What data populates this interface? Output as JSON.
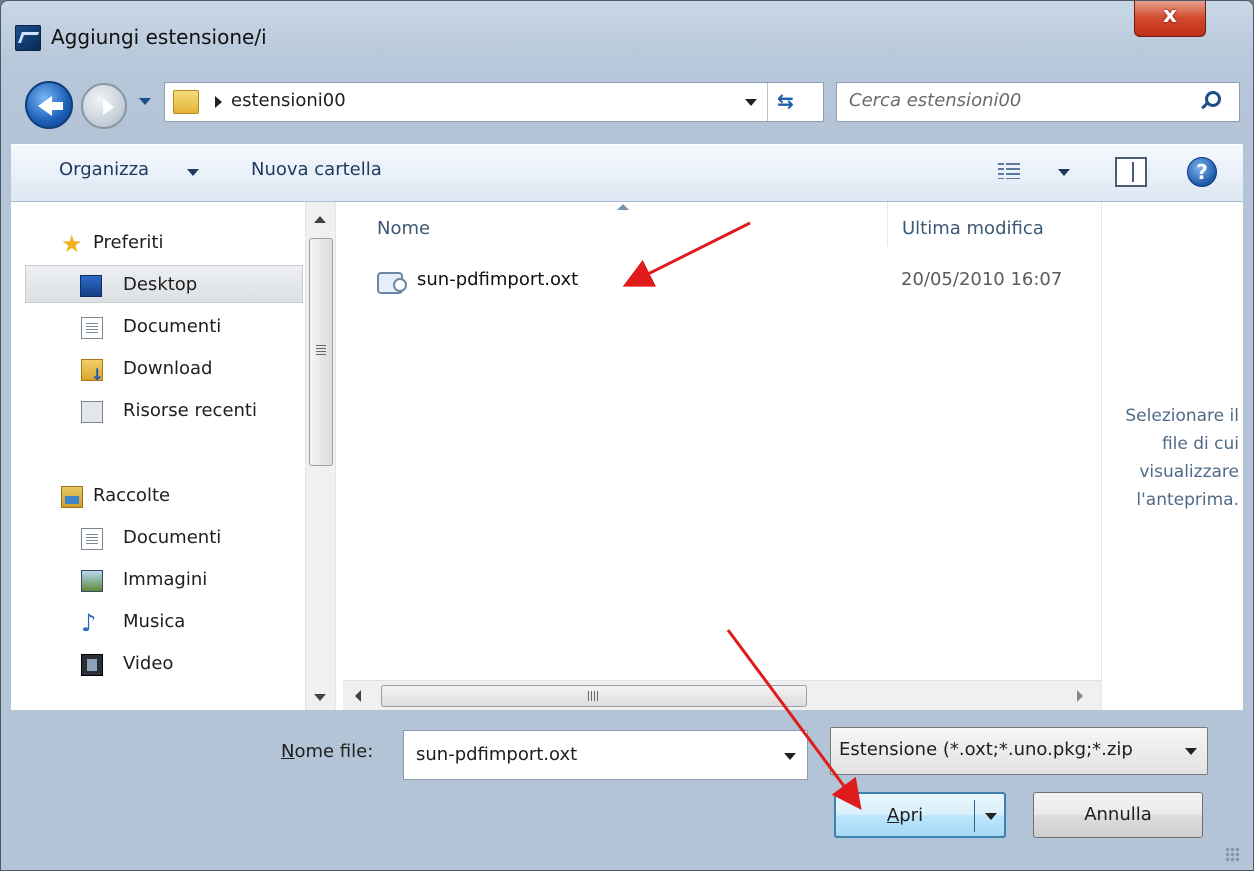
{
  "window": {
    "title": "Aggiungi estensione/i",
    "close_label": "x"
  },
  "address": {
    "path": "estensioni00"
  },
  "search": {
    "placeholder": "Cerca estensioni00"
  },
  "toolbar": {
    "organize_label": "Organizza",
    "new_folder_label": "Nuova cartella"
  },
  "sidebar": {
    "favorites_header": "Preferiti",
    "favorites": [
      "Desktop",
      "Documenti",
      "Download",
      "Risorse recenti"
    ],
    "libraries_header": "Raccolte",
    "libraries": [
      "Documenti",
      "Immagini",
      "Musica",
      "Video"
    ],
    "selected": "Desktop"
  },
  "file_list": {
    "columns": [
      "Nome",
      "Ultima modifica"
    ],
    "rows": [
      {
        "name": "sun-pdfimport.oxt",
        "modified": "20/05/2010 16:07"
      }
    ]
  },
  "preview_pane": {
    "message": "Selezionare il file di cui visualizzare l'anteprima."
  },
  "bottom": {
    "filename_label_accel": "N",
    "filename_label_rest": "ome file:",
    "filename_value": "sun-pdfimport.oxt",
    "filter_value": "Estensione (*.oxt;*.uno.pkg;*.zip",
    "open_accel": "A",
    "open_rest": "pri",
    "cancel_label": "Annulla"
  },
  "colors": {
    "annotation_arrow": "#e01b1b",
    "open_button_border": "#3c7fb1"
  }
}
